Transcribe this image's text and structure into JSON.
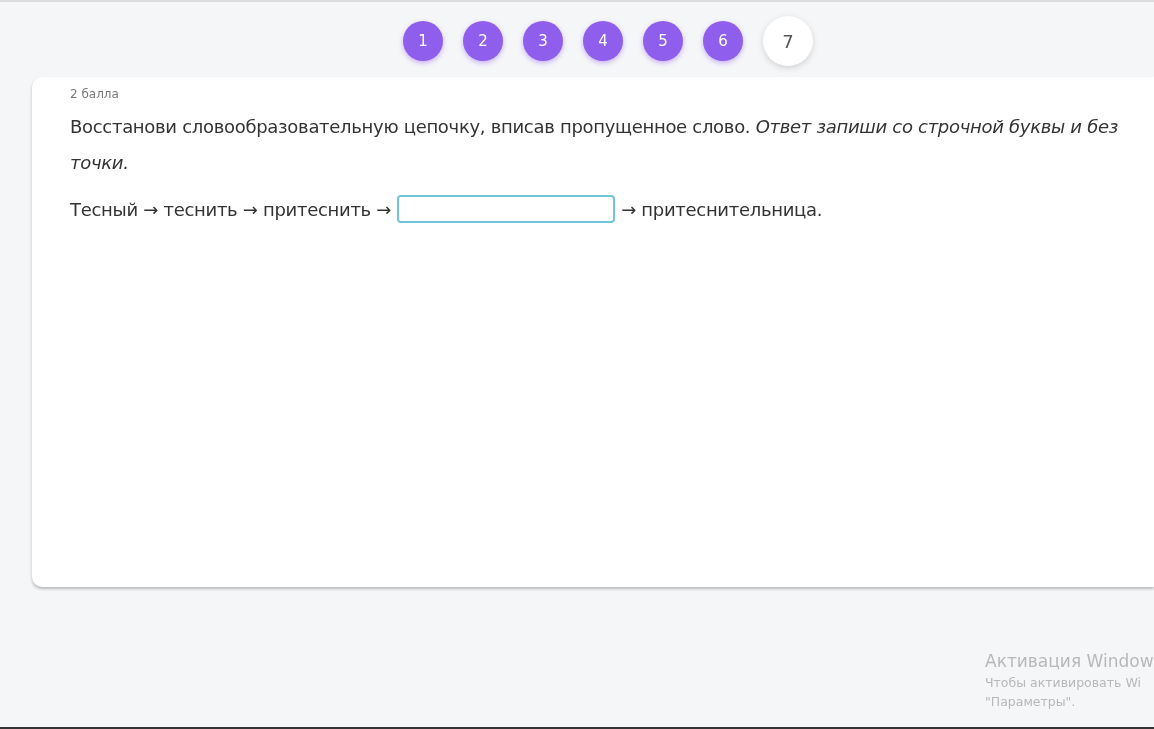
{
  "pager": [
    {
      "label": "1",
      "selected": false
    },
    {
      "label": "2",
      "selected": false
    },
    {
      "label": "3",
      "selected": false
    },
    {
      "label": "4",
      "selected": false
    },
    {
      "label": "5",
      "selected": false
    },
    {
      "label": "6",
      "selected": false
    },
    {
      "label": "7",
      "selected": true
    }
  ],
  "task": {
    "points": "2 балла",
    "instruction": "Восстанови словообразовательную цепочку, вписав пропущенное слово. *Ответ запиши со строчной буквы и без точки.*",
    "chain_before": "Тесный → теснить → притеснить →",
    "chain_after": "→ притеснительница."
  },
  "os_notice": {
    "title": "Активация Window",
    "line_1": "Чтобы активировать Wi",
    "line_2": "\"Параметры\"."
  }
}
